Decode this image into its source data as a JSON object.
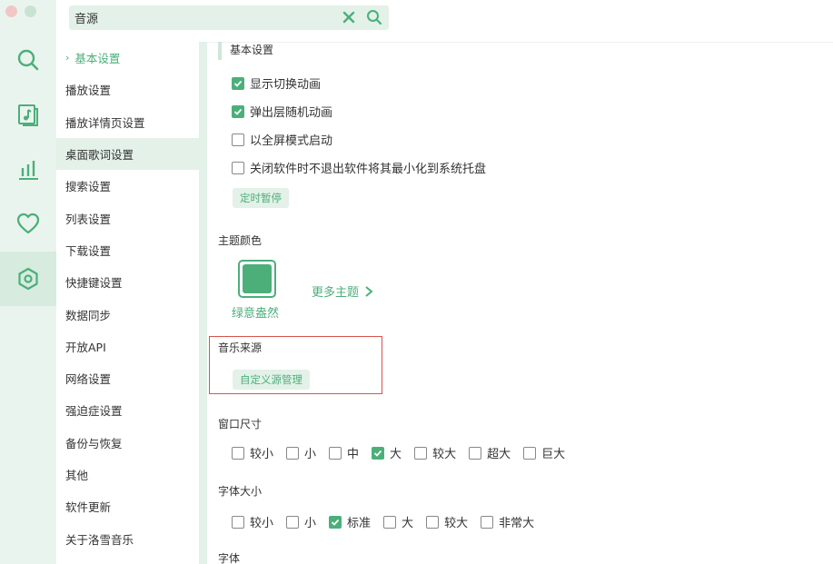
{
  "colors": {
    "accent": "#4caf7a",
    "rail_bg": "#eaf4ee",
    "pill_bg": "#e3f1e8",
    "highlight": "#d9534f"
  },
  "window": {
    "traffic_lights": [
      "#f1c7c5",
      "#c9e3d2"
    ]
  },
  "rail": {
    "icons": [
      "search-icon",
      "music-file-icon",
      "chart-bars-icon",
      "heart-icon",
      "settings-hexagon-icon"
    ]
  },
  "search": {
    "value": "音源",
    "placeholder": ""
  },
  "nav": {
    "items": [
      {
        "label": "基本设置"
      },
      {
        "label": "播放设置"
      },
      {
        "label": "播放详情页设置"
      },
      {
        "label": "桌面歌词设置"
      },
      {
        "label": "搜索设置"
      },
      {
        "label": "列表设置"
      },
      {
        "label": "下载设置"
      },
      {
        "label": "快捷键设置"
      },
      {
        "label": "数据同步"
      },
      {
        "label": "开放API"
      },
      {
        "label": "网络设置"
      },
      {
        "label": "强迫症设置"
      },
      {
        "label": "备份与恢复"
      },
      {
        "label": "其他"
      },
      {
        "label": "软件更新"
      },
      {
        "label": "关于洛雪音乐"
      }
    ]
  },
  "basic": {
    "title": "基本设置",
    "options": [
      {
        "label": "显示切换动画",
        "checked": true
      },
      {
        "label": "弹出层随机动画",
        "checked": true
      },
      {
        "label": "以全屏模式启动",
        "checked": false
      },
      {
        "label": "关闭软件时不退出软件将其最小化到系统托盘",
        "checked": false
      }
    ],
    "timer_button": "定时暂停"
  },
  "theme": {
    "title": "主题颜色",
    "current_name": "绿意盎然",
    "more_label": "更多主题"
  },
  "source": {
    "title": "音乐来源",
    "manage_button": "自定义源管理"
  },
  "window_size": {
    "title": "窗口尺寸",
    "options": [
      {
        "label": "较小",
        "checked": false
      },
      {
        "label": "小",
        "checked": false
      },
      {
        "label": "中",
        "checked": false
      },
      {
        "label": "大",
        "checked": true
      },
      {
        "label": "较大",
        "checked": false
      },
      {
        "label": "超大",
        "checked": false
      },
      {
        "label": "巨大",
        "checked": false
      }
    ]
  },
  "font_size": {
    "title": "字体大小",
    "options": [
      {
        "label": "较小",
        "checked": false
      },
      {
        "label": "小",
        "checked": false
      },
      {
        "label": "标准",
        "checked": true
      },
      {
        "label": "大",
        "checked": false
      },
      {
        "label": "较大",
        "checked": false
      },
      {
        "label": "非常大",
        "checked": false
      }
    ]
  },
  "font": {
    "title": "字体"
  }
}
